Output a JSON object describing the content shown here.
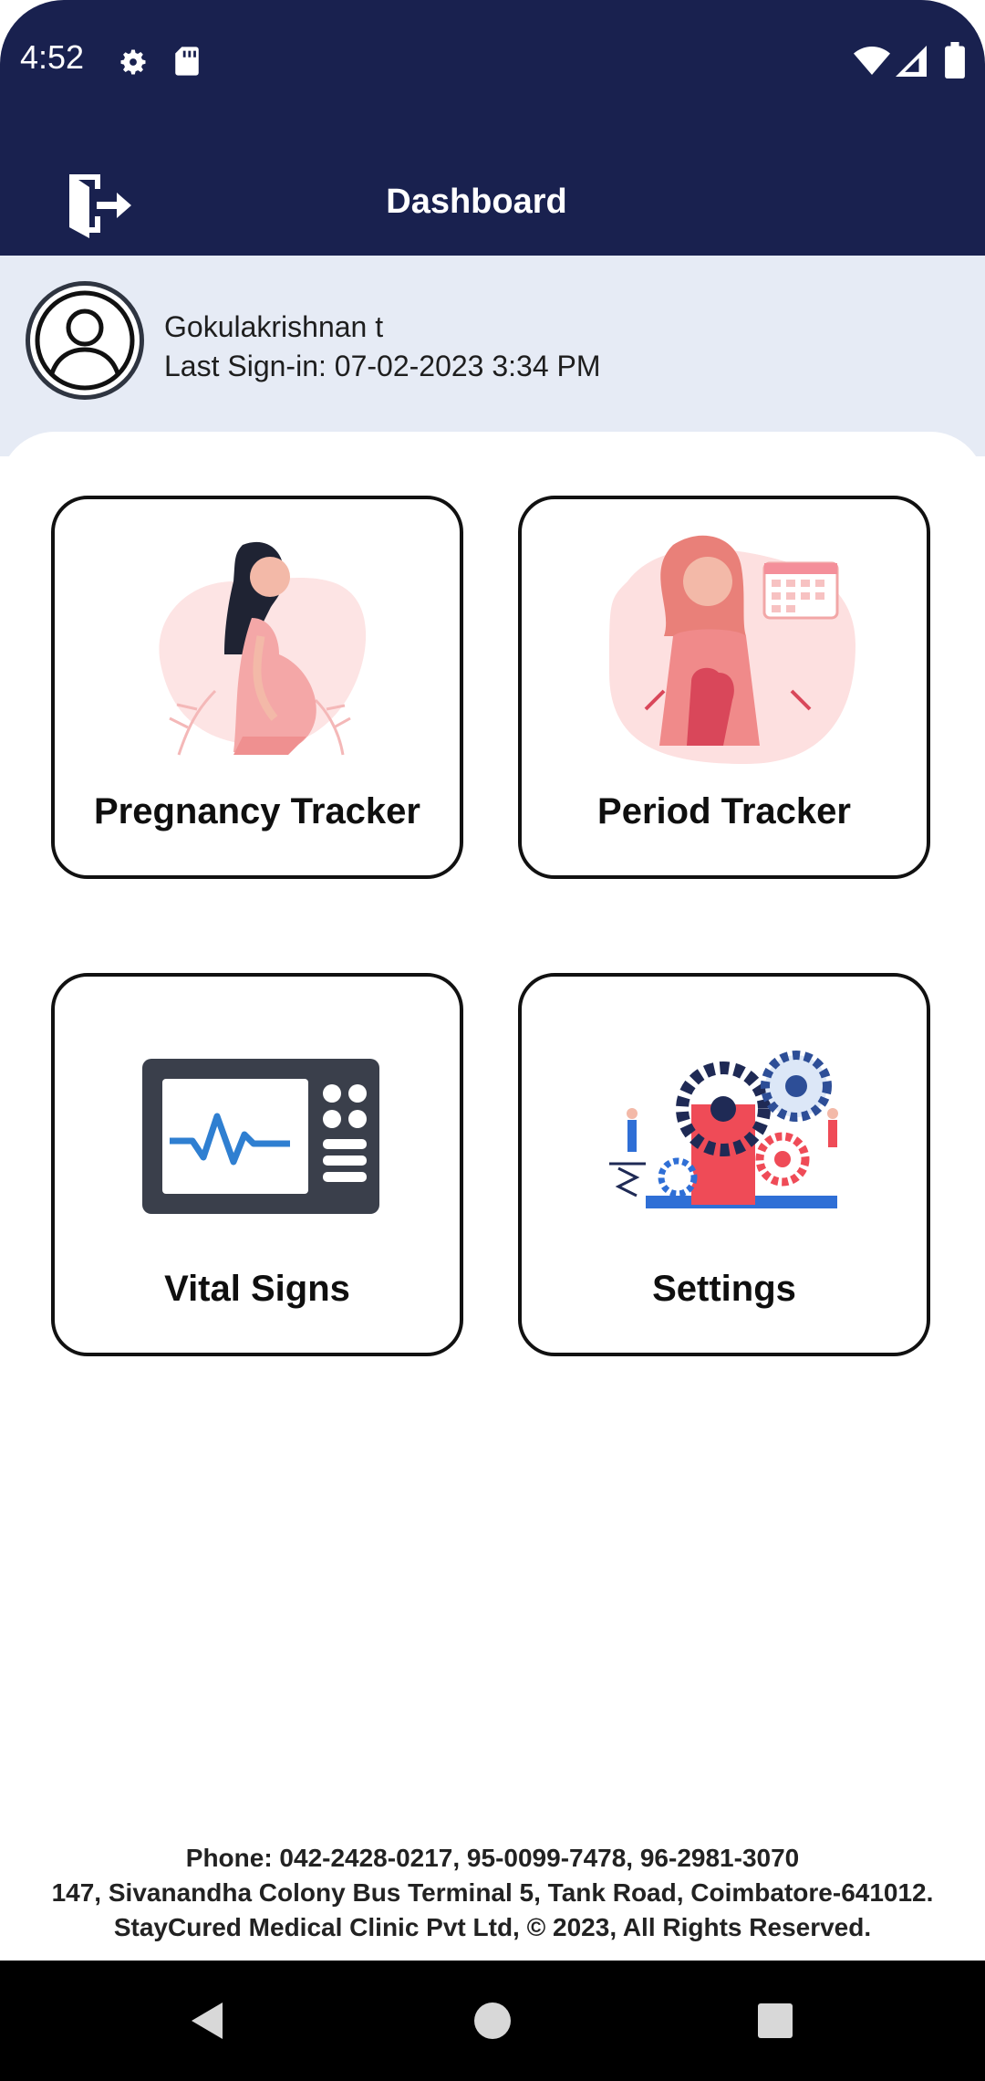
{
  "status_bar": {
    "time": "4:52",
    "icons": [
      "gear-icon",
      "sd-card-icon",
      "wifi-icon",
      "signal-icon",
      "battery-icon"
    ]
  },
  "app_bar": {
    "title": "Dashboard",
    "logout_icon": "logout-icon",
    "background": "#19214f"
  },
  "profile": {
    "name": "Gokulakrishnan t",
    "last_sign_in": "Last Sign-in: 07-02-2023  3:34 PM"
  },
  "tiles": [
    {
      "label": "Pregnancy Tracker",
      "icon": "pregnant-woman-illustration"
    },
    {
      "label": "Period Tracker",
      "icon": "period-illustration"
    },
    {
      "label": "Vital Signs",
      "icon": "vital-monitor-icon"
    },
    {
      "label": "Settings",
      "icon": "gears-illustration"
    }
  ],
  "footer": {
    "phone": "Phone: 042-2428-0217, 95-0099-7478, 96-2981-3070",
    "address": "147, Sivanandha Colony Bus Terminal 5, Tank Road, Coimbatore-641012.",
    "copyright": "StayCured Medical Clinic Pvt Ltd, © 2023, All Rights Reserved."
  },
  "nav_bar": {
    "buttons": [
      "back-icon",
      "home-icon",
      "recents-icon"
    ]
  }
}
